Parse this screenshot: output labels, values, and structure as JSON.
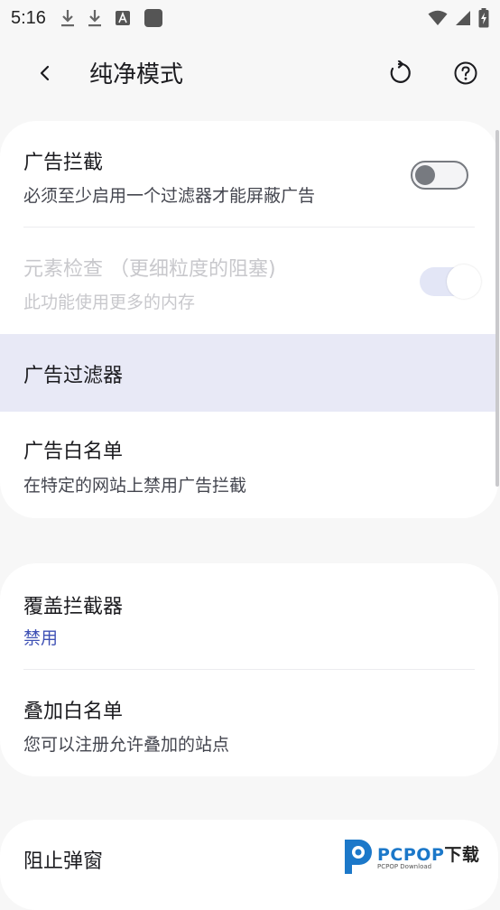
{
  "status": {
    "time": "5:16",
    "icons_left": [
      "download-icon",
      "download-icon",
      "text-a-icon",
      "square-icon"
    ],
    "icons_right": [
      "wifi-icon",
      "signal-icon",
      "battery-charging-icon"
    ]
  },
  "app_bar": {
    "title": "纯净模式",
    "icons": [
      "back-arrow-icon",
      "refresh-icon",
      "help-icon"
    ]
  },
  "section1": {
    "ad_block": {
      "title": "广告拦截",
      "subtitle": "必须至少启用一个过滤器才能屏蔽广告",
      "toggle": "off"
    },
    "element_inspect": {
      "title": "元素检查 （更细粒度的阻塞)",
      "subtitle": "此功能使用更多的内存",
      "toggle": "on-disabled"
    },
    "ad_filters": {
      "title": "广告过滤器"
    },
    "ad_whitelist": {
      "title": "广告白名单",
      "subtitle": "在特定的网站上禁用广告拦截"
    }
  },
  "section2": {
    "overlay_blocker": {
      "title": "覆盖拦截器",
      "value": "禁用"
    },
    "overlay_whitelist": {
      "title": "叠加白名单",
      "subtitle": "您可以注册允许叠加的站点"
    }
  },
  "section3": {
    "popup_block": {
      "title": "阻止弹窗"
    }
  },
  "watermark": {
    "text_main": "PCPOP",
    "text_dl": "下载",
    "sub": "PCPOP Download"
  },
  "colors": {
    "accent": "#3f51b5",
    "highlight": "#e8e9f6",
    "background": "#f7f7f7"
  }
}
